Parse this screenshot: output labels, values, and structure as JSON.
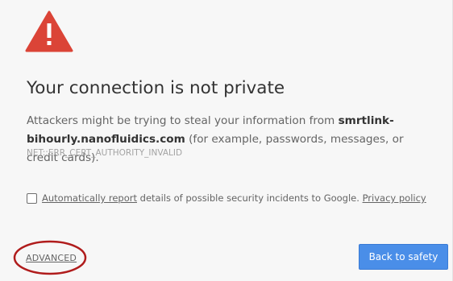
{
  "icon": "warning-triangle-icon",
  "heading": "Your connection is not private",
  "message": {
    "intro": "Attackers might be trying to steal your information from ",
    "host": "smrtlink-bihourly.nanofluidics.com",
    "suffix": " (for example, passwords, messages, or credit cards)."
  },
  "error_code": "NET::ERR_CERT_AUTHORITY_INVALID",
  "report": {
    "checked": false,
    "link_text": "Automatically report",
    "text": " details of possible security incidents to Google. ",
    "privacy_link": "Privacy policy"
  },
  "advanced_label": "ADVANCED",
  "back_button": "Back to safety",
  "colors": {
    "warning_red": "#db4437",
    "primary_blue": "#4a8ee8",
    "annotation_red": "#b01c1c"
  }
}
